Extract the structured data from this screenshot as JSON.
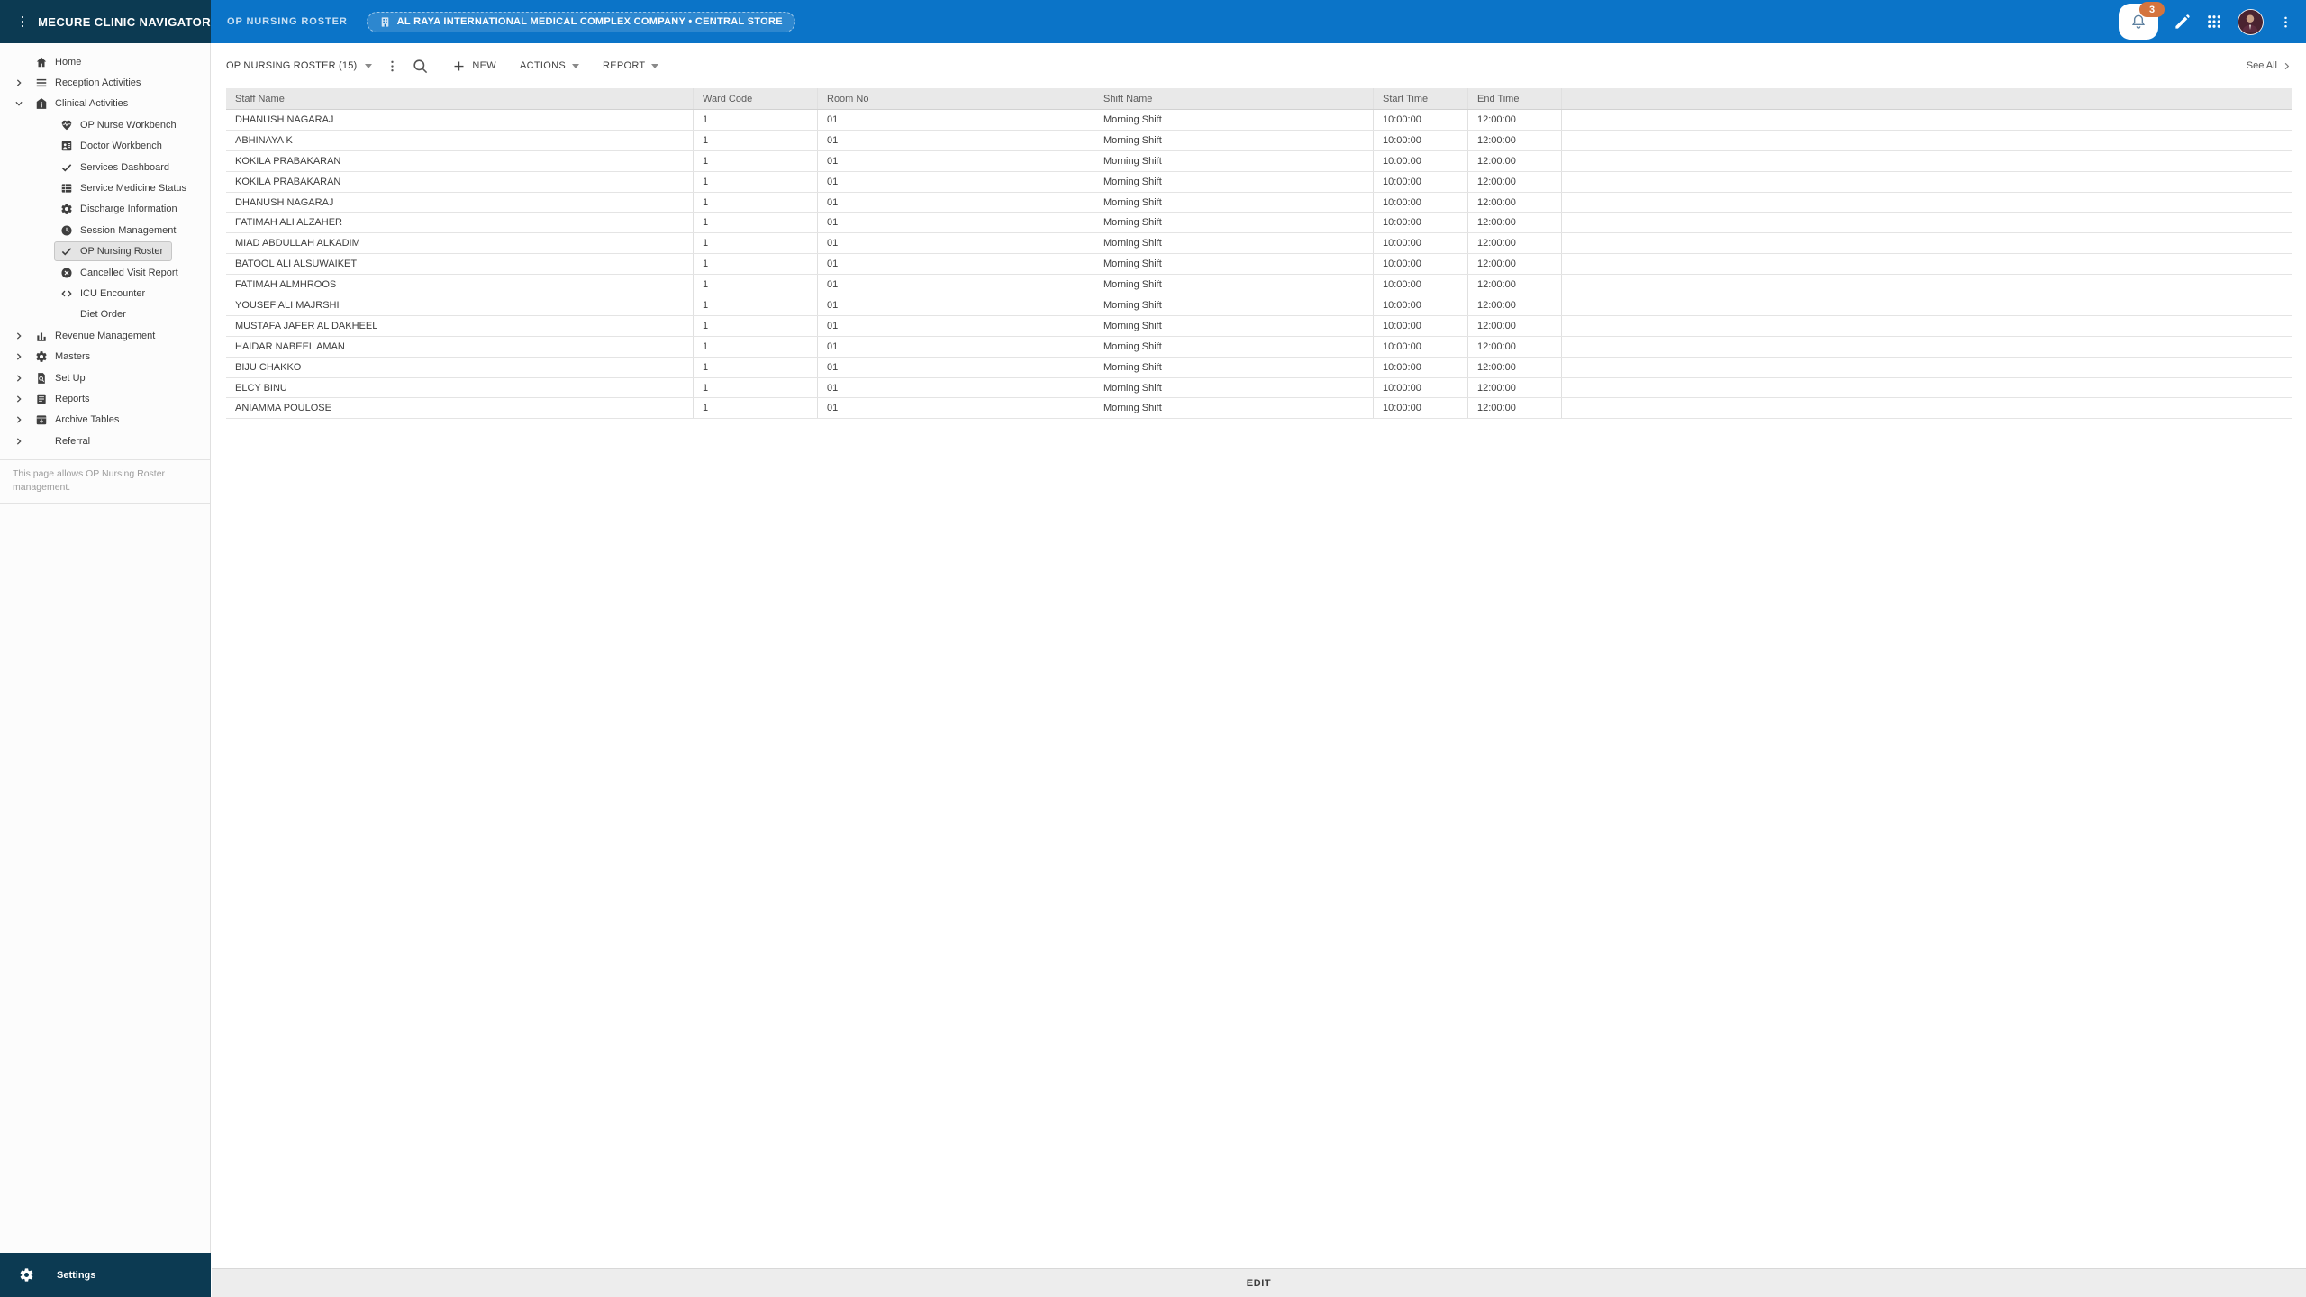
{
  "colors": {
    "brand_navy": "#0c3a52",
    "top_bar_blue": "#0b74c8",
    "badge_orange": "#d4743e",
    "selected_item_bg": "#e4e4e4"
  },
  "header": {
    "app_title": "MECURE CLINIC NAVIGATOR",
    "page_label": "OP NURSING ROSTER",
    "org_pill": "AL RAYA INTERNATIONAL MEDICAL COMPLEX COMPANY • CENTRAL STORE",
    "notification_count": "3"
  },
  "sidebar": {
    "items": [
      {
        "label": "Home",
        "icon": "home",
        "level": 0
      },
      {
        "label": "Reception Activities",
        "icon": "menu",
        "level": 0,
        "chevron": "right"
      },
      {
        "label": "Clinical Activities",
        "icon": "clinical",
        "level": 0,
        "chevron": "down"
      },
      {
        "label": "OP Nurse Workbench",
        "icon": "nurse",
        "level": 1
      },
      {
        "label": "Doctor Workbench",
        "icon": "doctor",
        "level": 1
      },
      {
        "label": "Services Dashboard",
        "icon": "check",
        "level": 1
      },
      {
        "label": "Service Medicine Status",
        "icon": "grid-table",
        "level": 1
      },
      {
        "label": "Discharge Information",
        "icon": "gear",
        "level": 1
      },
      {
        "label": "Session Management",
        "icon": "clock",
        "level": 1
      },
      {
        "label": "OP Nursing Roster",
        "icon": "check",
        "level": 1,
        "selected": true
      },
      {
        "label": "Cancelled Visit Report",
        "icon": "cancel",
        "level": 1
      },
      {
        "label": "ICU Encounter",
        "icon": "code",
        "level": 1
      },
      {
        "label": "Diet Order",
        "icon": "",
        "level": 1
      },
      {
        "label": "Revenue Management",
        "icon": "chart",
        "level": 0,
        "chevron": "right"
      },
      {
        "label": "Masters",
        "icon": "gear",
        "level": 0,
        "chevron": "right"
      },
      {
        "label": "Set Up",
        "icon": "doc-search",
        "level": 0,
        "chevron": "right"
      },
      {
        "label": "Reports",
        "icon": "doc",
        "level": 0,
        "chevron": "right"
      },
      {
        "label": "Archive Tables",
        "icon": "archive",
        "level": 0,
        "chevron": "right"
      },
      {
        "label": "Referral",
        "icon": "",
        "level": 0,
        "chevron": "right"
      }
    ],
    "note": "This page allows OP Nursing Roster management.",
    "settings_label": "Settings"
  },
  "toolbar": {
    "view_selector": "OP NURSING ROSTER (15)",
    "new_label": "NEW",
    "actions_label": "ACTIONS",
    "report_label": "REPORT",
    "see_all_label": "See All"
  },
  "table": {
    "columns": [
      "Staff Name",
      "Ward Code",
      "Room No",
      "Shift Name",
      "Start Time",
      "End Time"
    ],
    "rows": [
      {
        "staff": "DHANUSH NAGARAJ",
        "ward": "1",
        "room": "01",
        "shift": "Morning Shift",
        "start": "10:00:00",
        "end": "12:00:00"
      },
      {
        "staff": "ABHINAYA K",
        "ward": "1",
        "room": "01",
        "shift": "Morning Shift",
        "start": "10:00:00",
        "end": "12:00:00"
      },
      {
        "staff": "KOKILA PRABAKARAN",
        "ward": "1",
        "room": "01",
        "shift": "Morning Shift",
        "start": "10:00:00",
        "end": "12:00:00"
      },
      {
        "staff": "KOKILA PRABAKARAN",
        "ward": "1",
        "room": "01",
        "shift": "Morning Shift",
        "start": "10:00:00",
        "end": "12:00:00"
      },
      {
        "staff": "DHANUSH NAGARAJ",
        "ward": "1",
        "room": "01",
        "shift": "Morning Shift",
        "start": "10:00:00",
        "end": "12:00:00"
      },
      {
        "staff": "FATIMAH ALI ALZAHER",
        "ward": "1",
        "room": "01",
        "shift": "Morning Shift",
        "start": "10:00:00",
        "end": "12:00:00"
      },
      {
        "staff": "MIAD ABDULLAH ALKADIM",
        "ward": "1",
        "room": "01",
        "shift": "Morning Shift",
        "start": "10:00:00",
        "end": "12:00:00"
      },
      {
        "staff": "BATOOL ALI ALSUWAIKET",
        "ward": "1",
        "room": "01",
        "shift": "Morning Shift",
        "start": "10:00:00",
        "end": "12:00:00"
      },
      {
        "staff": "FATIMAH ALMHROOS",
        "ward": "1",
        "room": "01",
        "shift": "Morning Shift",
        "start": "10:00:00",
        "end": "12:00:00"
      },
      {
        "staff": "YOUSEF ALI MAJRSHI",
        "ward": "1",
        "room": "01",
        "shift": "Morning Shift",
        "start": "10:00:00",
        "end": "12:00:00"
      },
      {
        "staff": "MUSTAFA JAFER AL DAKHEEL",
        "ward": "1",
        "room": "01",
        "shift": "Morning Shift",
        "start": "10:00:00",
        "end": "12:00:00"
      },
      {
        "staff": "HAIDAR NABEEL AMAN",
        "ward": "1",
        "room": "01",
        "shift": "Morning Shift",
        "start": "10:00:00",
        "end": "12:00:00"
      },
      {
        "staff": "BIJU CHAKKO",
        "ward": "1",
        "room": "01",
        "shift": "Morning Shift",
        "start": "10:00:00",
        "end": "12:00:00"
      },
      {
        "staff": "ELCY BINU",
        "ward": "1",
        "room": "01",
        "shift": "Morning Shift",
        "start": "10:00:00",
        "end": "12:00:00"
      },
      {
        "staff": "ANIAMMA POULOSE",
        "ward": "1",
        "room": "01",
        "shift": "Morning Shift",
        "start": "10:00:00",
        "end": "12:00:00"
      }
    ]
  },
  "footer": {
    "edit_label": "EDIT"
  }
}
